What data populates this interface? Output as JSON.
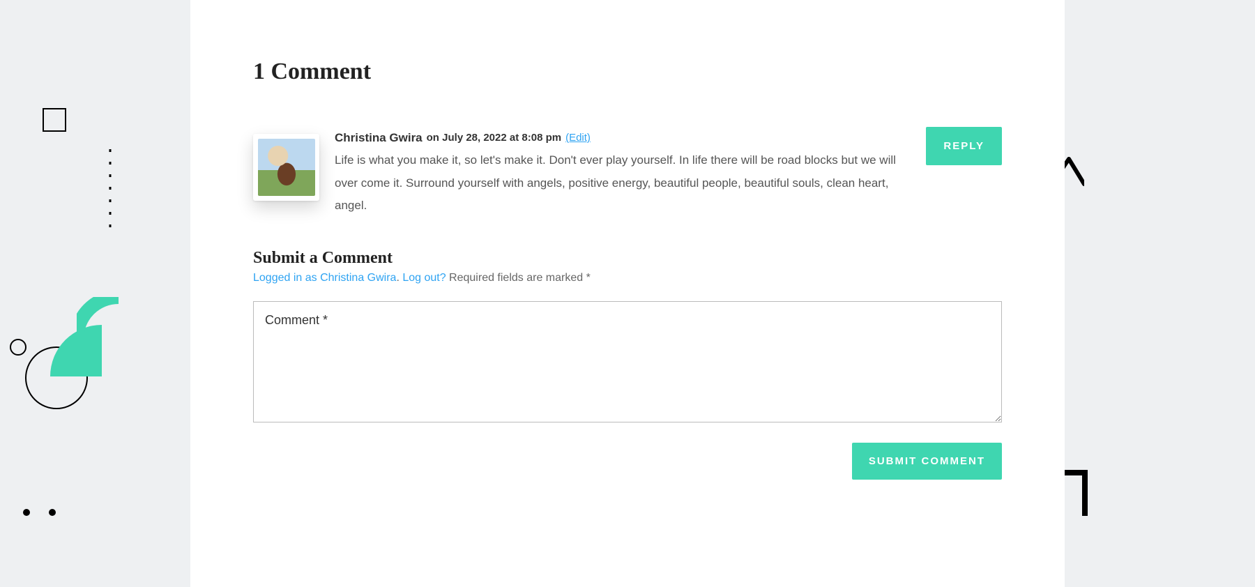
{
  "comments": {
    "section_title": "1 Comment",
    "items": [
      {
        "author": "Christina Gwira",
        "on_word": "on",
        "date": "July 28, 2022 at 8:08 pm",
        "edit_label": "(Edit)",
        "body": "Life is what you make it, so let's make it. Don't ever play yourself. In life there will be road blocks but we will over come it. Surround yourself with angels, positive energy, beautiful people, beautiful souls, clean heart, angel.",
        "reply_label": "REPLY"
      }
    ]
  },
  "form": {
    "title": "Submit a Comment",
    "logged_in_prefix": "Logged in as Christina Gwira",
    "logged_in_sep": ". ",
    "logout_label": "Log out?",
    "required_note": " Required fields are marked *",
    "placeholder": "Comment *",
    "submit_label": "SUBMIT COMMENT"
  }
}
